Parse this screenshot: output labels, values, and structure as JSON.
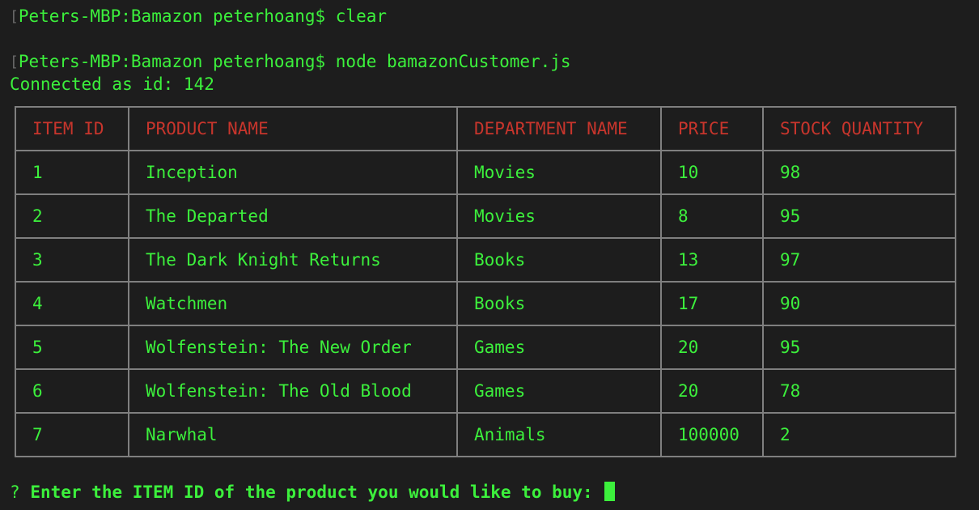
{
  "terminal": {
    "lines": [
      {
        "bracket": "[",
        "text": "Peters-MBP:Bamazon peterhoang$ clear"
      },
      {
        "bracket": "[",
        "text": "Peters-MBP:Bamazon peterhoang$ node bamazonCustomer.js"
      },
      {
        "bracket": "",
        "text": "Connected as id: 142"
      }
    ],
    "table": {
      "headers": [
        "ITEM ID",
        "PRODUCT NAME",
        "DEPARTMENT NAME",
        "PRICE",
        "STOCK QUANTITY"
      ],
      "rows": [
        [
          "1",
          "Inception",
          "Movies",
          "10",
          "98"
        ],
        [
          "2",
          "The Departed",
          "Movies",
          "8",
          "95"
        ],
        [
          "3",
          "The Dark Knight Returns",
          "Books",
          "13",
          "97"
        ],
        [
          "4",
          "Watchmen",
          "Books",
          "17",
          "90"
        ],
        [
          "5",
          "Wolfenstein: The New Order",
          "Games",
          "20",
          "95"
        ],
        [
          "6",
          "Wolfenstein: The Old Blood",
          "Games",
          "20",
          "78"
        ],
        [
          "7",
          "Narwhal",
          "Animals",
          "100000",
          "2"
        ]
      ]
    },
    "prompt": {
      "qmark": "?",
      "text": "Enter the ITEM ID of the product you would like to buy:"
    }
  },
  "colors": {
    "background": "#1d1d1d",
    "text_green": "#3cf03c",
    "header_red": "#c7352c",
    "border_gray": "#7f7f7f"
  }
}
